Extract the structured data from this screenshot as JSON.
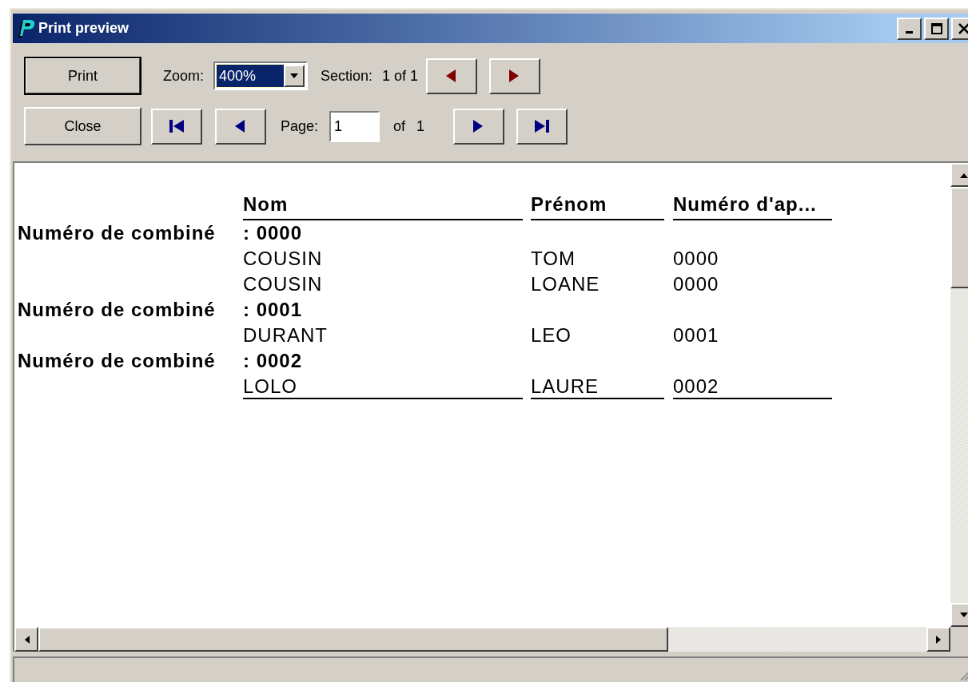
{
  "window": {
    "title": "Print preview"
  },
  "toolbar": {
    "print_button": "Print",
    "close_button": "Close",
    "zoom": {
      "label": "Zoom:",
      "value": "400%",
      "focused": true
    },
    "section": {
      "label": "Section:",
      "value": "1 of 1",
      "buttons": [
        {
          "kind": "prev"
        },
        {
          "kind": "next"
        }
      ]
    },
    "page": {
      "label": "Page:",
      "value": "1",
      "of_label": "of",
      "of_value": "1",
      "back_buttons": [
        {
          "kind": "first"
        },
        {
          "kind": "prev"
        }
      ],
      "forward_buttons": [
        {
          "kind": "next"
        },
        {
          "kind": "last"
        }
      ]
    }
  },
  "report": {
    "columns": [
      "Nom",
      "Prénom",
      "Numéro d'ap..."
    ],
    "groups": [
      {
        "label": "Numéro de combiné",
        "value": ": 0000",
        "rows": [
          [
            "COUSIN",
            "TOM",
            "0000"
          ],
          [
            "COUSIN",
            "LOANE",
            "0000"
          ]
        ]
      },
      {
        "label": "Numéro de combiné",
        "value": ": 0001",
        "rows": [
          [
            "DURANT",
            "LEO",
            "0001"
          ]
        ]
      },
      {
        "label": "Numéro de combiné",
        "value": ": 0002",
        "rows": [
          [
            "LOLO",
            "LAURE",
            "0002"
          ]
        ]
      }
    ]
  }
}
